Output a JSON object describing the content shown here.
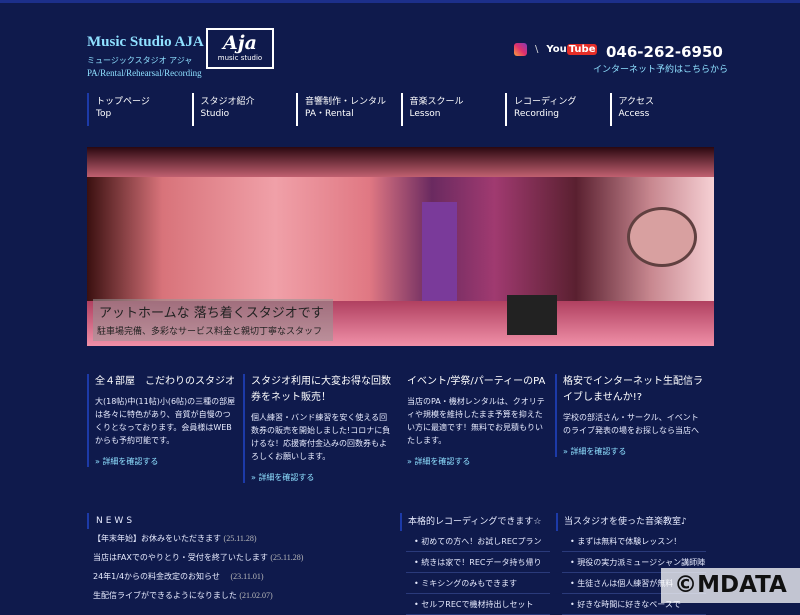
{
  "header": {
    "title": "Music Studio AJA",
    "kana": "ミュージックスタジオ アジャ",
    "subtitle": "PA/Rental/Rehearsal/Recording",
    "logo_big": "Aja",
    "logo_small": "music studio",
    "social": {
      "x": "\\",
      "youtube_a": "You",
      "youtube_b": "Tube"
    },
    "phone": "046-262-6950",
    "reserve": "インターネット予約はこちらから"
  },
  "nav": [
    {
      "ja": "トップページ",
      "en": "Top"
    },
    {
      "ja": "スタジオ紹介",
      "en": "Studio"
    },
    {
      "ja": "音響制作・レンタル",
      "en": "PA・Rental"
    },
    {
      "ja": "音楽スクール",
      "en": "Lesson"
    },
    {
      "ja": "レコーディング",
      "en": "Recording"
    },
    {
      "ja": "アクセス",
      "en": "Access"
    }
  ],
  "hero": {
    "caption_title": "アットホームな 落ち着くスタジオです",
    "caption_sub": "駐車場完備、多彩なサービス料金と親切丁寧なスタッフ"
  },
  "cards": [
    {
      "title": "全４部屋　こだわりのスタジオ",
      "body": "大(18帖)中(11帖)小(6帖)の三種の部屋は各々に特色があり、音質が自慢のつくりとなっております。会員様はWEBからも予約可能です。",
      "link": "» 詳細を確認する"
    },
    {
      "title": "スタジオ利用に大変お得な回数券をネット販売！",
      "body": "個人練習・バンド練習を安く使える回数券の販売を開始しました!コロナに負けるな！応援寄付金込みの回数券もよろしくお願いします。",
      "link": "» 詳細を確認する"
    },
    {
      "title": "イベント/学祭/パーティーのPA",
      "body": "当店のPA・機材レンタルは、クオリティや規模を維持したまま予算を抑えたい方に最適です！無料でお見積もりいたします。",
      "link": "» 詳細を確認する"
    },
    {
      "title": "格安でインターネット生配信ライブしませんか!?",
      "body": "学校の部活さん・サークル、イベントのライブ発表の場をお探しなら当店へ",
      "link": "» 詳細を確認する"
    }
  ],
  "news": {
    "title": "NEWS",
    "items": [
      {
        "text": "【年末年始】お休みをいただきます",
        "date": "(25.11.28)"
      },
      {
        "text": "当店はFAXでのやりとり・受付を終了いたします",
        "date": "(25.11.28)"
      },
      {
        "text": "24年1/4からの料金改定のお知らせ　",
        "date": "(23.11.01)"
      },
      {
        "text": "生配信ライブができるようになりました",
        "date": "(21.02.07)"
      }
    ]
  },
  "recording": {
    "title": "本格的レコーディングできます☆",
    "items": [
      "初めての方へ！お試しRECプラン",
      "続きは家で！RECデータ持ち帰り",
      "ミキシングのみもできます",
      "セルフRECで機材持出しセット"
    ]
  },
  "school": {
    "title": "当スタジオを使った音楽教室♪",
    "items": [
      "まずは無料で体験レッスン！",
      "現役の実力派ミュージシャン講師陣",
      "生徒さんは個人練習が無料",
      "好きな時間に好きなペースで"
    ]
  },
  "watermark": "©MDATA"
}
